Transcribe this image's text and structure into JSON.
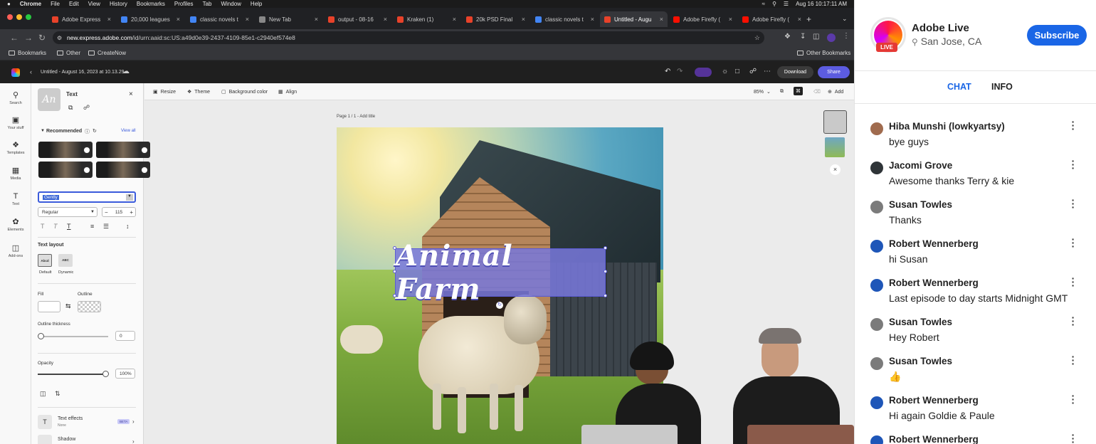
{
  "mac": {
    "apple": "",
    "app": "Chrome",
    "menus": [
      "File",
      "Edit",
      "View",
      "History",
      "Bookmarks",
      "Profiles",
      "Tab",
      "Window",
      "Help"
    ],
    "clock": "Aug 16  10:17:11 AM"
  },
  "tabs": [
    {
      "label": "Adobe Express",
      "color": "#e8422a"
    },
    {
      "label": "20,000 leagues",
      "color": "#4285f4"
    },
    {
      "label": "classic novels t",
      "color": "#4285f4"
    },
    {
      "label": "New Tab",
      "color": "#888888"
    },
    {
      "label": "output - 08-16",
      "color": "#e8422a"
    },
    {
      "label": "Kraken (1)",
      "color": "#e8422a"
    },
    {
      "label": "20k PSD Final",
      "color": "#e8422a"
    },
    {
      "label": "classic novels t",
      "color": "#4285f4"
    },
    {
      "label": "Untitled - Augu",
      "color": "#e8422a"
    },
    {
      "label": "Adobe Firefly (",
      "color": "#fa0f00"
    },
    {
      "label": "Adobe Firefly (",
      "color": "#fa0f00"
    }
  ],
  "address": {
    "host": "new.express.adobe.com",
    "path": "/id/urn:aaid:sc:US:a49d0e39-2437-4109-85e1-c2940ef574e8"
  },
  "bookmarks": {
    "left": [
      "Bookmarks",
      "Other",
      "CreateNow"
    ],
    "right": "Other Bookmarks"
  },
  "express": {
    "doc_title": "Untitled - August 16, 2023 at 10.13.29",
    "download": "Download",
    "share": "Share",
    "rail": [
      "Search",
      "Your stuff",
      "Templates",
      "Media",
      "Text",
      "Elements",
      "Add-ons"
    ],
    "panel": {
      "title": "Text",
      "recommended": "Recommended",
      "view_all": "View all",
      "font": "Gently",
      "weight": "Regular",
      "size": "115",
      "text_layout": "Text layout",
      "layout_default": "Default",
      "layout_dynamic": "Dynamic",
      "fill": "Fill",
      "outline": "Outline",
      "outline_thickness": "Outline thickness",
      "outline_value": "0",
      "opacity": "Opacity",
      "opacity_value": "100%",
      "effects": "Text effects",
      "effects_sub": "None",
      "beta": "BETA",
      "shadow": "Shadow",
      "thumb_text": "An"
    },
    "toolbar": {
      "resize": "Resize",
      "theme": "Theme",
      "background": "Background color",
      "align": "Align",
      "zoom": "85%",
      "add": "Add"
    },
    "page_label": "Page 1 / 1 - Add title",
    "canvas_text": "Animal Farm"
  },
  "chat": {
    "channel": "Adobe Live",
    "location": "San Jose, CA",
    "subscribe": "Subscribe",
    "live": "LIVE",
    "tabs": [
      "CHAT",
      "INFO"
    ],
    "messages": [
      {
        "user": "Hiba Munshi (lowkyartsy)",
        "text": "bye guys",
        "avatar": "#a06b4e"
      },
      {
        "user": "Jacomi Grove",
        "text": "Awesome thanks Terry & kie",
        "avatar": "#2f3438"
      },
      {
        "user": "Susan Towles",
        "text": "Thanks",
        "avatar": "#7b7b7b"
      },
      {
        "user": "Robert Wennerberg",
        "text": "hi Susan",
        "avatar": "#1e56b8"
      },
      {
        "user": "Robert Wennerberg",
        "text": "Last episode to day starts Midnight GMT",
        "avatar": "#1e56b8"
      },
      {
        "user": "Susan Towles",
        "text": "Hey Robert",
        "avatar": "#7b7b7b"
      },
      {
        "user": "Susan Towles",
        "text": "👍",
        "avatar": "#7b7b7b"
      },
      {
        "user": "Robert Wennerberg",
        "text": "Hi again Goldie & Paule",
        "avatar": "#1e56b8"
      },
      {
        "user": "Robert Wennerberg",
        "text": "",
        "avatar": "#1e56b8"
      }
    ]
  }
}
